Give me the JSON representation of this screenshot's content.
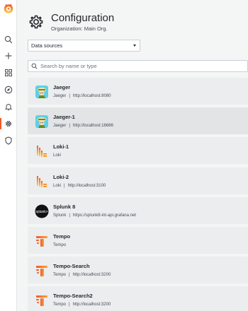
{
  "sidebar": {
    "items": [
      {
        "icon": "search-icon"
      },
      {
        "icon": "plus-icon"
      },
      {
        "icon": "dashboards-icon"
      },
      {
        "icon": "compass-icon"
      },
      {
        "icon": "bell-icon"
      },
      {
        "icon": "gear-icon",
        "active": true
      },
      {
        "icon": "shield-icon"
      }
    ]
  },
  "header": {
    "title": "Configuration",
    "subtitle": "Organization: Main Org."
  },
  "tab_select": {
    "value": "Data sources"
  },
  "search": {
    "placeholder": "Search by name or type",
    "value": ""
  },
  "datasources": [
    {
      "name": "Jaeger",
      "type": "Jaeger",
      "url": "http://localhost:8080",
      "logo": "jaeger-logo"
    },
    {
      "name": "Jaeger-1",
      "type": "Jaeger",
      "url": "http://localhost:16686",
      "logo": "jaeger-logo"
    },
    {
      "name": "Loki-1",
      "type": "Loki",
      "url": "",
      "logo": "loki-logo"
    },
    {
      "name": "Loki-2",
      "type": "Loki",
      "url": "http://localhost:3100",
      "logo": "loki-logo"
    },
    {
      "name": "Splunk 8",
      "type": "Splunk",
      "url": "https://splunk8-int-api.grafana.net",
      "logo": "splunk-logo"
    },
    {
      "name": "Tempo",
      "type": "Tempo",
      "url": "",
      "logo": "tempo-logo"
    },
    {
      "name": "Tempo-Search",
      "type": "Tempo",
      "url": "http://localhost:3200",
      "logo": "tempo-logo"
    },
    {
      "name": "Tempo-Search2",
      "type": "Tempo",
      "url": "http://localhost:3200",
      "logo": "tempo-logo"
    }
  ],
  "colors": {
    "accent": "#f05a28",
    "card_bg": "#ebedee",
    "page_bg": "#f4f5f5"
  }
}
